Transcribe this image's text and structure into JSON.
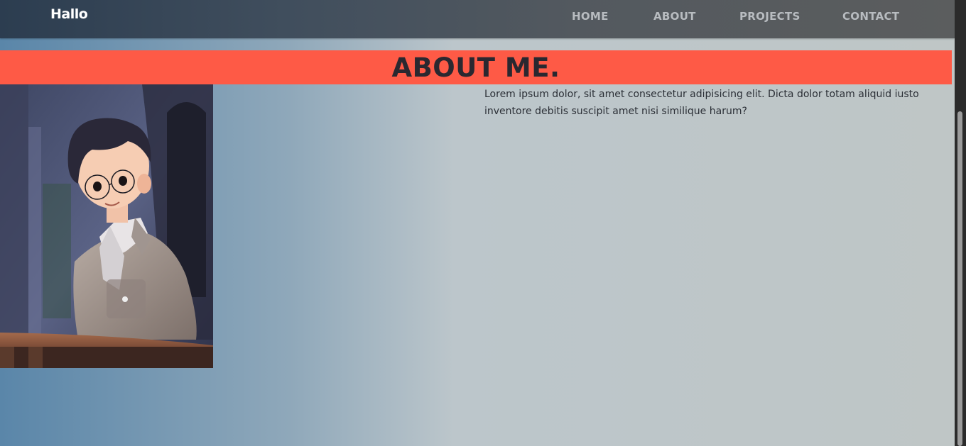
{
  "navbar": {
    "brand": "Hallo",
    "links": [
      "HOME",
      "ABOUT",
      "PROJECTS",
      "CONTACT"
    ]
  },
  "about": {
    "title": "ABOUT ME.",
    "description": "Lorem ipsum dolor, sit amet consectetur adipisicing elit. Dicta dolor totam aliquid iusto inventore debitis suscipit amet nisi similique harum?"
  },
  "colors": {
    "accent": "#fe5a46",
    "navbar": "#404e5d",
    "title_text": "#2a2830"
  }
}
